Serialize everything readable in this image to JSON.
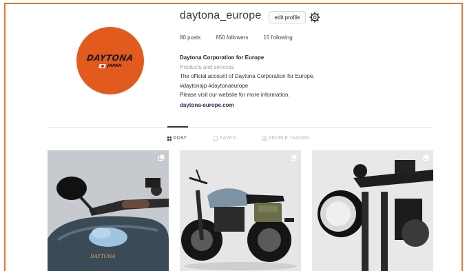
{
  "profile": {
    "username": "daytona_europe",
    "edit_label": "edit profile",
    "avatar_brand": "DAYTONA",
    "avatar_sub": "JAPAN",
    "stats": {
      "posts": "80 posts",
      "followers": "850 followers",
      "following": "15 following"
    },
    "bio": {
      "name": "Daytona Corporation for Europe",
      "category": "Products and services",
      "line1": "The official account of Daytona Corporation for Europe.",
      "hashtags": "#daytonajp #daytonaeurope",
      "line3": "Please visit our website for more information.",
      "website": "daytona-europe.com"
    }
  },
  "tabs": {
    "post": "POST",
    "saved": "SAVED",
    "tagged": "PEOPLE TAGGED"
  },
  "posts": {
    "tank_logo": "DAYTONA"
  },
  "colors": {
    "frame": "#e8762e",
    "avatar": "#e35a1e"
  }
}
